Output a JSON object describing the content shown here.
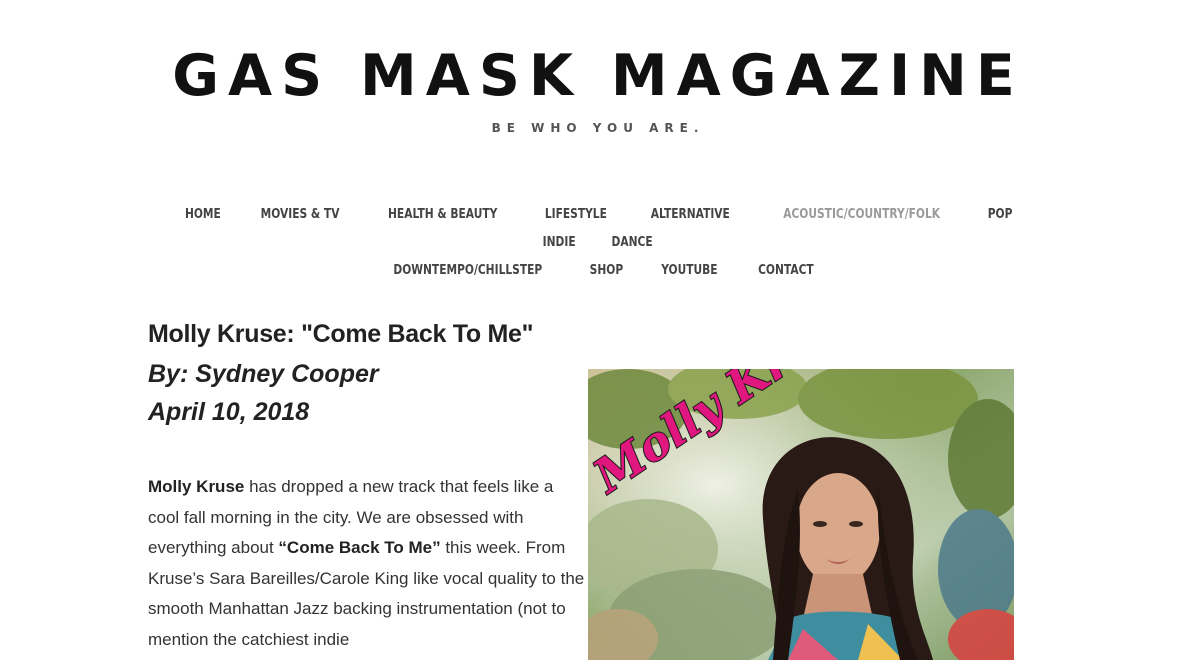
{
  "header": {
    "title": "GAS MASK MAGAZINE",
    "tagline": "BE WHO YOU ARE."
  },
  "nav": {
    "items": [
      {
        "label": "HOME"
      },
      {
        "label": "MOVIES & TV"
      },
      {
        "label": "HEALTH & BEAUTY"
      },
      {
        "label": "LIFESTYLE"
      },
      {
        "label": "ALTERNATIVE"
      },
      {
        "label": "ACOUSTIC/COUNTRY/FOLK",
        "active": true
      },
      {
        "label": "POP"
      },
      {
        "label": "INDIE"
      },
      {
        "label": "DANCE"
      },
      {
        "label": "DOWNTEMPO/CHILLSTEP"
      },
      {
        "label": "SHOP"
      },
      {
        "label": "YOUTUBE"
      },
      {
        "label": "CONTACT"
      }
    ]
  },
  "article": {
    "headline": "Molly Kruse: \"Come Back To Me\"",
    "byline": "By: Sydney Cooper",
    "date": "April 10, 2018",
    "p_artist": "Molly Kruse",
    "p_text1": " has dropped a new track that feels like a cool fall morning in the city. We are obsessed with everything about ",
    "p_song": "“Come Back To Me”",
    "p_text2": " this week. From Kruse’s Sara Bareilles/Carole King like vocal quality to the smooth Manhattan Jazz backing instrumentation (not to mention the catchiest indie",
    "image_title": "Molly Kruse"
  },
  "colors": {
    "accent_pink": "#e0177f",
    "active_nav": "#9a9a9a"
  }
}
